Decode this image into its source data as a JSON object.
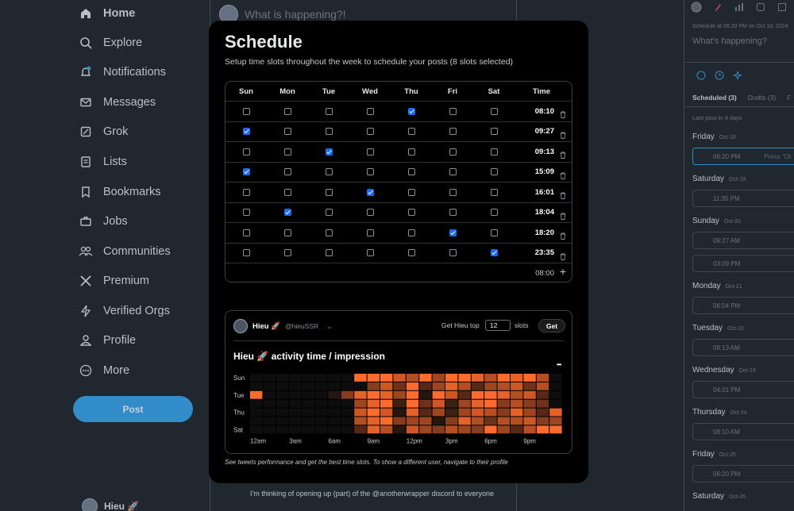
{
  "nav": {
    "items": [
      {
        "label": "Home",
        "icon": "home-icon",
        "active": true
      },
      {
        "label": "Explore",
        "icon": "search-icon"
      },
      {
        "label": "Notifications",
        "icon": "bell-icon"
      },
      {
        "label": "Messages",
        "icon": "mail-icon"
      },
      {
        "label": "Grok",
        "icon": "grok-icon"
      },
      {
        "label": "Lists",
        "icon": "list-icon"
      },
      {
        "label": "Bookmarks",
        "icon": "bookmark-icon"
      },
      {
        "label": "Jobs",
        "icon": "briefcase-icon"
      },
      {
        "label": "Communities",
        "icon": "people-icon"
      },
      {
        "label": "Premium",
        "icon": "x-logo-icon"
      },
      {
        "label": "Verified Orgs",
        "icon": "lightning-icon"
      },
      {
        "label": "Profile",
        "icon": "person-icon"
      },
      {
        "label": "More",
        "icon": "more-icon"
      }
    ],
    "post_button": "Post",
    "user_name": "Hieu 🚀"
  },
  "center": {
    "compose_placeholder": "What is happening?!",
    "tweet_snippet": "I'm thinking of opening up (part) of the @anotherwrapper discord to everyone"
  },
  "right_panel": {
    "scheduled_note": "Schedule at 06:20 PM on Oct 18, 2024",
    "compose_placeholder": "What's happening?",
    "tabs": [
      "Scheduled (3)",
      "Drafts (3)",
      "F"
    ],
    "last_post": "Last post in 4 days",
    "press_hint": "Press \"Ot",
    "days": [
      {
        "day": "Friday",
        "date": "Oct-18",
        "slots": [
          "06:20 PM"
        ]
      },
      {
        "day": "Saturday",
        "date": "Oct-19",
        "slots": [
          "11:35 PM"
        ]
      },
      {
        "day": "Sunday",
        "date": "Oct-20",
        "slots": [
          "09:27 AM",
          "03:09 PM"
        ]
      },
      {
        "day": "Monday",
        "date": "Oct-21",
        "slots": [
          "06:04 PM"
        ]
      },
      {
        "day": "Tuesday",
        "date": "Oct-22",
        "slots": [
          "09:13 AM"
        ]
      },
      {
        "day": "Wednesday",
        "date": "Oct-23",
        "slots": [
          "04:01 PM"
        ]
      },
      {
        "day": "Thursday",
        "date": "Oct-24",
        "slots": [
          "08:10 AM"
        ]
      },
      {
        "day": "Friday",
        "date": "Oct-25",
        "slots": [
          "06:20 PM"
        ]
      },
      {
        "day": "Saturday",
        "date": "Oct-26",
        "slots": []
      }
    ]
  },
  "modal": {
    "title": "Schedule",
    "subtitle": "Setup time slots throughout the week to schedule your posts (8 slots selected)",
    "columns": [
      "Sun",
      "Mon",
      "Tue",
      "Wed",
      "Thu",
      "Fri",
      "Sat",
      "Time"
    ],
    "rows": [
      {
        "time": "08:10",
        "checked": [
          false,
          false,
          false,
          false,
          true,
          false,
          false
        ]
      },
      {
        "time": "09:27",
        "checked": [
          true,
          false,
          false,
          false,
          false,
          false,
          false
        ]
      },
      {
        "time": "09:13",
        "checked": [
          false,
          false,
          true,
          false,
          false,
          false,
          false
        ]
      },
      {
        "time": "15:09",
        "checked": [
          true,
          false,
          false,
          false,
          false,
          false,
          false
        ]
      },
      {
        "time": "16:01",
        "checked": [
          false,
          false,
          false,
          true,
          false,
          false,
          false
        ]
      },
      {
        "time": "18:04",
        "checked": [
          false,
          true,
          false,
          false,
          false,
          false,
          false
        ]
      },
      {
        "time": "18:20",
        "checked": [
          false,
          false,
          false,
          false,
          false,
          true,
          false
        ]
      },
      {
        "time": "23:35",
        "checked": [
          false,
          false,
          false,
          false,
          false,
          false,
          true
        ]
      }
    ],
    "new_slot_time": "08:00",
    "activity": {
      "user_name": "Hieu 🚀",
      "handle": "@hieuSSR",
      "get_top_label": "Get Hieu top",
      "slots_value": "12",
      "slots_label": "slots",
      "get_button": "Get",
      "title": "Hieu 🚀 activity time / impression",
      "menu_icon": "more-icon"
    },
    "footnote": "See tweets performance and get the best time slots. To show a different user, navigate to their profile"
  },
  "chart_data": {
    "type": "heatmap",
    "title": "Hieu 🚀 activity time / impression",
    "y_categories": [
      "Sun",
      "Mon",
      "Tue",
      "Wed",
      "Thu",
      "Fri",
      "Sat"
    ],
    "y_tick_labels": [
      "Sun",
      "Tue",
      "Thu",
      "Sat"
    ],
    "x_categories": [
      "0",
      "1",
      "2",
      "3",
      "4",
      "5",
      "6",
      "7",
      "8",
      "9",
      "10",
      "11",
      "12",
      "13",
      "14",
      "15",
      "16",
      "17",
      "18",
      "19",
      "20",
      "21",
      "22",
      "23"
    ],
    "x_tick_labels": [
      "12am",
      "3am",
      "6am",
      "9am",
      "12pm",
      "3pm",
      "6pm",
      "9pm"
    ],
    "color_scale": [
      "#0d0d0d",
      "#ff6a2e"
    ],
    "values": [
      [
        0.0,
        0.0,
        0.0,
        0.0,
        0.0,
        0.0,
        0.0,
        0.0,
        1.0,
        1.0,
        1.0,
        0.8,
        0.7,
        1.0,
        0.6,
        1.0,
        1.0,
        0.9,
        0.7,
        1.0,
        0.9,
        1.0,
        0.7,
        0.0
      ],
      [
        0.0,
        0.0,
        0.0,
        0.0,
        0.0,
        0.0,
        0.0,
        0.0,
        0.0,
        0.5,
        0.8,
        0.4,
        1.0,
        0.3,
        0.6,
        0.9,
        0.7,
        0.3,
        0.6,
        0.7,
        0.8,
        0.4,
        0.7,
        0.0
      ],
      [
        1.0,
        0.0,
        0.0,
        0.0,
        0.0,
        0.0,
        0.1,
        0.5,
        0.9,
        1.0,
        0.9,
        0.6,
        1.0,
        0.1,
        1.0,
        0.8,
        0.3,
        1.0,
        1.0,
        0.9,
        0.7,
        0.8,
        0.3,
        0.0
      ],
      [
        0.0,
        0.0,
        0.0,
        0.0,
        0.0,
        0.0,
        0.0,
        0.0,
        0.6,
        0.9,
        1.0,
        0.2,
        1.0,
        0.4,
        0.8,
        0.2,
        0.6,
        0.9,
        1.0,
        0.5,
        0.7,
        0.5,
        0.4,
        0.0
      ],
      [
        0.0,
        0.0,
        0.0,
        0.0,
        0.0,
        0.0,
        0.0,
        0.0,
        0.8,
        1.0,
        0.8,
        0.1,
        0.9,
        0.3,
        0.6,
        0.2,
        0.6,
        0.8,
        0.7,
        0.5,
        0.9,
        0.6,
        0.3,
        0.9
      ],
      [
        0.0,
        0.0,
        0.0,
        0.0,
        0.0,
        0.0,
        0.0,
        0.0,
        0.7,
        0.9,
        1.0,
        0.5,
        0.6,
        0.6,
        0.1,
        0.5,
        0.9,
        0.7,
        0.4,
        0.7,
        0.7,
        0.8,
        0.5,
        0.6
      ],
      [
        0.0,
        0.0,
        0.0,
        0.0,
        0.0,
        0.0,
        0.0,
        0.0,
        0.3,
        0.9,
        0.7,
        0.1,
        0.8,
        0.6,
        0.5,
        0.7,
        0.6,
        0.5,
        1.0,
        0.6,
        0.3,
        0.7,
        1.0,
        1.0
      ]
    ]
  }
}
